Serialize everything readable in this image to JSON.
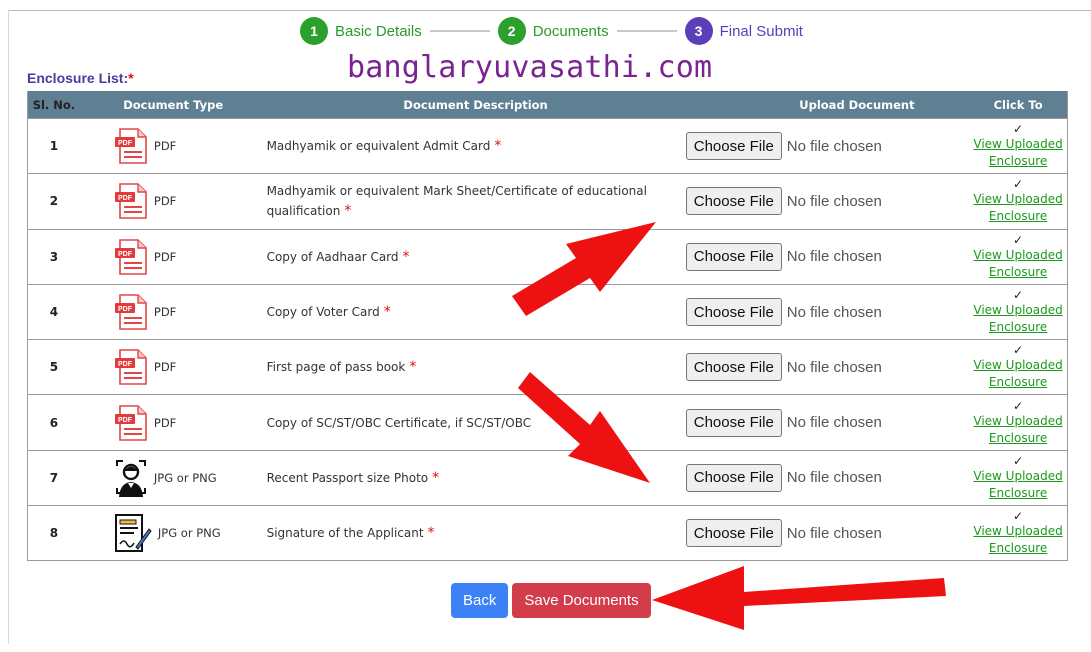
{
  "stepper": {
    "steps": [
      {
        "number": "1",
        "label": "Basic Details",
        "color": "#2ca02c"
      },
      {
        "number": "2",
        "label": "Documents",
        "color": "#2ca02c"
      },
      {
        "number": "3",
        "label": "Final Submit",
        "color": "#5a3fb8"
      }
    ]
  },
  "watermark": "banglaryuvasathi.com",
  "enclosure": {
    "title": "Enclosure List:",
    "required_mark": "*"
  },
  "table": {
    "headers": [
      "Sl. No.",
      "Document Type",
      "Document Description",
      "Upload Document",
      "Click To"
    ],
    "rows": [
      {
        "sl": "1",
        "type": "PDF",
        "icon": "pdf-icon",
        "description": "Madhyamik or equivalent Admit Card",
        "required": "*",
        "file_button": "Choose File",
        "file_status": "No file chosen",
        "check": "✓",
        "link_line1": "View Uploaded",
        "link_line2": "Enclosure"
      },
      {
        "sl": "2",
        "type": "PDF",
        "icon": "pdf-icon",
        "description": "Madhyamik or equivalent Mark Sheet/Certificate of educational qualification",
        "required": "*",
        "file_button": "Choose File",
        "file_status": "No file chosen",
        "check": "✓",
        "link_line1": "View Uploaded",
        "link_line2": "Enclosure"
      },
      {
        "sl": "3",
        "type": "PDF",
        "icon": "pdf-icon",
        "description": "Copy of Aadhaar Card",
        "required": "*",
        "file_button": "Choose File",
        "file_status": "No file chosen",
        "check": "✓",
        "link_line1": "View Uploaded",
        "link_line2": "Enclosure"
      },
      {
        "sl": "4",
        "type": "PDF",
        "icon": "pdf-icon",
        "description": "Copy of Voter Card",
        "required": "*",
        "file_button": "Choose File",
        "file_status": "No file chosen",
        "check": "✓",
        "link_line1": "View Uploaded",
        "link_line2": "Enclosure"
      },
      {
        "sl": "5",
        "type": "PDF",
        "icon": "pdf-icon",
        "description": "First page of pass book",
        "required": "*",
        "file_button": "Choose File",
        "file_status": "No file chosen",
        "check": "✓",
        "link_line1": "View Uploaded",
        "link_line2": "Enclosure"
      },
      {
        "sl": "6",
        "type": "PDF",
        "icon": "pdf-icon",
        "description": "Copy of SC/ST/OBC Certificate, if SC/ST/OBC",
        "required": "",
        "file_button": "Choose File",
        "file_status": "No file chosen",
        "check": "✓",
        "link_line1": "View Uploaded",
        "link_line2": "Enclosure"
      },
      {
        "sl": "7",
        "type": "JPG or PNG",
        "icon": "passport-photo-icon",
        "description": "Recent Passport size Photo",
        "required": "*",
        "file_button": "Choose File",
        "file_status": "No file chosen",
        "check": "✓",
        "link_line1": "View Uploaded",
        "link_line2": "Enclosure"
      },
      {
        "sl": "8",
        "type": "JPG or PNG",
        "icon": "signature-icon",
        "description": "Signature of the Applicant",
        "required": "*",
        "file_button": "Choose File",
        "file_status": "No file chosen",
        "check": "✓",
        "link_line1": "View Uploaded",
        "link_line2": "Enclosure"
      }
    ]
  },
  "actions": {
    "back_label": "Back",
    "save_label": "Save Documents"
  },
  "colors": {
    "header_bg": "#5f7f93",
    "link": "#1a9a1a",
    "required": "#d11111",
    "back_button": "#3c82f6",
    "save_button": "#d33c4a",
    "annotation_arrow": "#ee1111"
  }
}
